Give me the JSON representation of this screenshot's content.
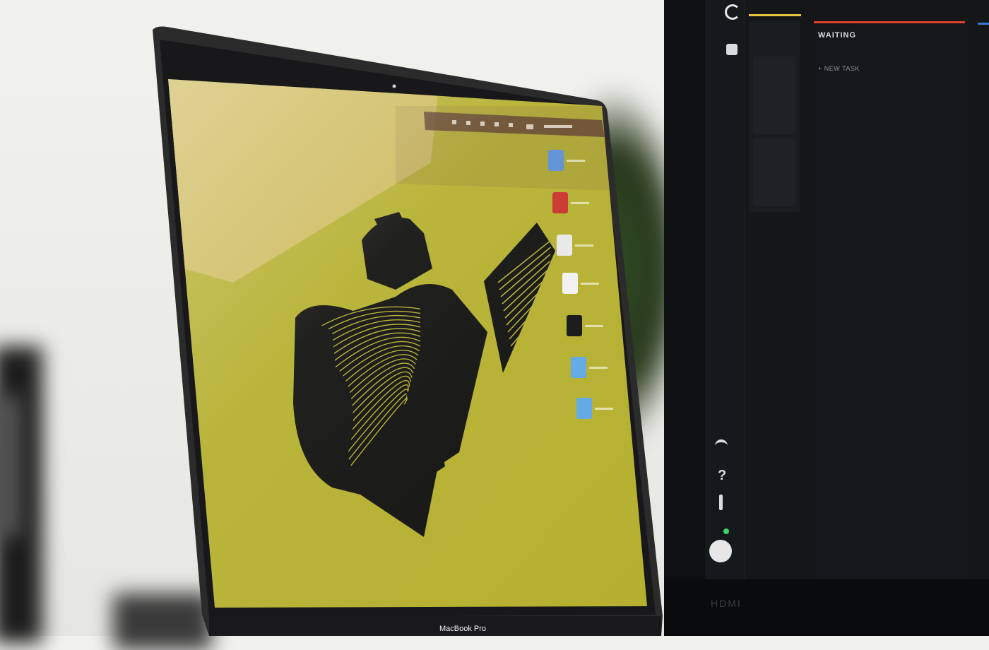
{
  "scene": {
    "description_free": true
  },
  "monitor_app": {
    "columns": [
      {
        "label": "WAITING",
        "accent": "#e0412f"
      }
    ],
    "new_task_label": "+ NEW TASK",
    "rail_icons": [
      "logo-icon",
      "grid-icon",
      "wifi-icon",
      "help-icon",
      "info-icon",
      "power-icon"
    ],
    "accent_yellow": "#e8c23a",
    "accent_red": "#e0412f",
    "status_green": "#3ed46a"
  },
  "monitor_brand": "HDMI",
  "laptop": {
    "model_label": "MacBook Pro",
    "wallpaper_color": "#b5b02f",
    "artwork_color": "#0f0f0d",
    "desktop_icons": [
      {
        "name": "drive-icon",
        "color": "#5b8fd6"
      },
      {
        "name": "creative-cloud-icon",
        "color": "#c8322a"
      },
      {
        "name": "document-icon",
        "color": "#e8e8e8"
      },
      {
        "name": "file-icon",
        "color": "#f2f2f2"
      },
      {
        "name": "black-file-icon",
        "color": "#151515"
      },
      {
        "name": "folder-icon",
        "color": "#5fa8e6"
      },
      {
        "name": "folder-icon",
        "color": "#5fa8e6"
      }
    ]
  }
}
